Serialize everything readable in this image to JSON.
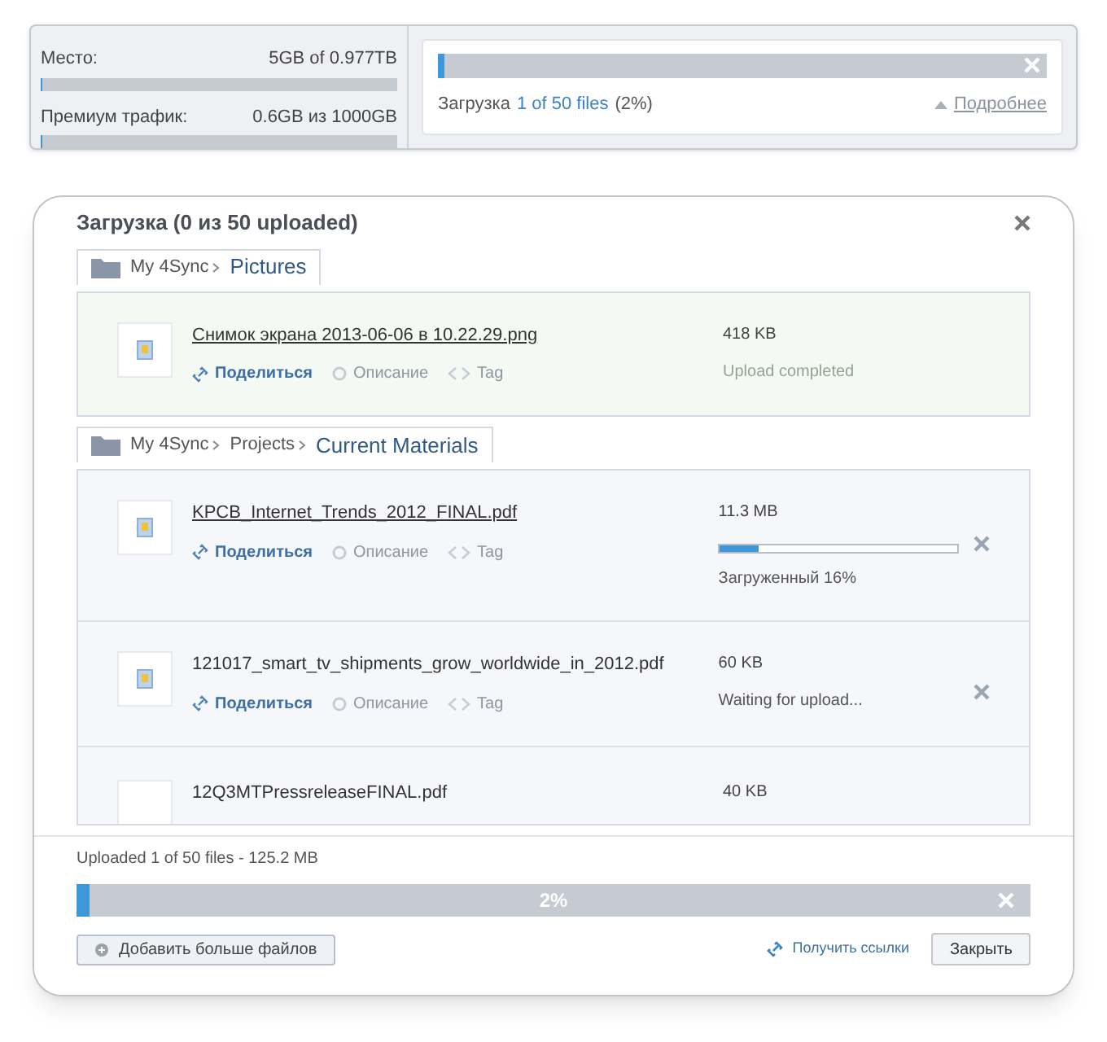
{
  "storage": {
    "space": {
      "label": "Место:",
      "value": "5GB of 0.977TB",
      "level": 0.005
    },
    "traffic": {
      "label": "Премиум трафик:",
      "value": "0.6GB из 1000GB",
      "level": 0.0006
    }
  },
  "mini_upload": {
    "level": 0.02,
    "prefix": "Загрузка",
    "count": "1 of 50 files",
    "percent": "(2%)",
    "details": "Подробнее"
  },
  "dialog": {
    "title": "Загрузка (0 из 50 uploaded)",
    "groups": [
      {
        "path": [
          "My 4Sync"
        ],
        "folder": "Pictures",
        "files": [
          {
            "kind": "completed",
            "name": "Снимок экрана 2013-06-06 в 10.22.29.png",
            "size": "418 KB",
            "status": "Upload completed",
            "actions": [
              "Поделиться",
              "Описание",
              "Tag"
            ]
          }
        ]
      },
      {
        "path": [
          "My 4Sync",
          "Projects"
        ],
        "folder": "Current Materials",
        "files": [
          {
            "kind": "uploading",
            "name": "KPCB_Internet_Trends_2012_FINAL.pdf",
            "size": "11.3 MB",
            "level": 0.16,
            "status": "Загруженный 16%",
            "actions": [
              "Поделиться",
              "Описание",
              "Tag"
            ]
          },
          {
            "kind": "waiting",
            "name": "121017_smart_tv_shipments_grow_worldwide_in_2012.pdf",
            "size": "60 KB",
            "status": "Waiting for upload...",
            "actions": [
              "Поделиться",
              "Описание",
              "Tag"
            ]
          },
          {
            "kind": "partial",
            "name": "12Q3MTPressreleaseFINAL.pdf",
            "size": "40 KB"
          }
        ]
      }
    ],
    "summary": "Uploaded 1 of 50 files - 125.2 MB",
    "total": {
      "level": 0.02,
      "label": "2%"
    },
    "add_button": "Добавить больше файлов",
    "links_button": "Получить ссылки",
    "close_button": "Закрыть"
  }
}
